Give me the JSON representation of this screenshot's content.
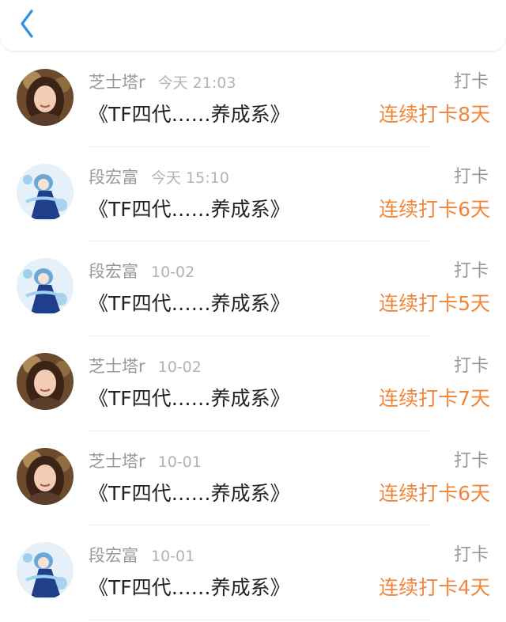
{
  "header": {
    "back_icon": "chevron-left-icon",
    "accent_color": "#2e8fe6"
  },
  "colors": {
    "streak": "#f0863b",
    "meta": "#999999"
  },
  "items": [
    {
      "user": "芝士塔r",
      "time": "今天 21:03",
      "title": "《TF四代……养成系》",
      "action": "打卡",
      "streak": "连续打卡8天",
      "avatar": "girl-avatar"
    },
    {
      "user": "段宏富",
      "time": "今天 15:10",
      "title": "《TF四代……养成系》",
      "action": "打卡",
      "streak": "连续打卡6天",
      "avatar": "anime-avatar"
    },
    {
      "user": "段宏富",
      "time": "10-02",
      "title": "《TF四代……养成系》",
      "action": "打卡",
      "streak": "连续打卡5天",
      "avatar": "anime-avatar"
    },
    {
      "user": "芝士塔r",
      "time": "10-02",
      "title": "《TF四代……养成系》",
      "action": "打卡",
      "streak": "连续打卡7天",
      "avatar": "girl-avatar"
    },
    {
      "user": "芝士塔r",
      "time": "10-01",
      "title": "《TF四代……养成系》",
      "action": "打卡",
      "streak": "连续打卡6天",
      "avatar": "girl-avatar"
    },
    {
      "user": "段宏富",
      "time": "10-01",
      "title": "《TF四代……养成系》",
      "action": "打卡",
      "streak": "连续打卡4天",
      "avatar": "anime-avatar"
    }
  ]
}
